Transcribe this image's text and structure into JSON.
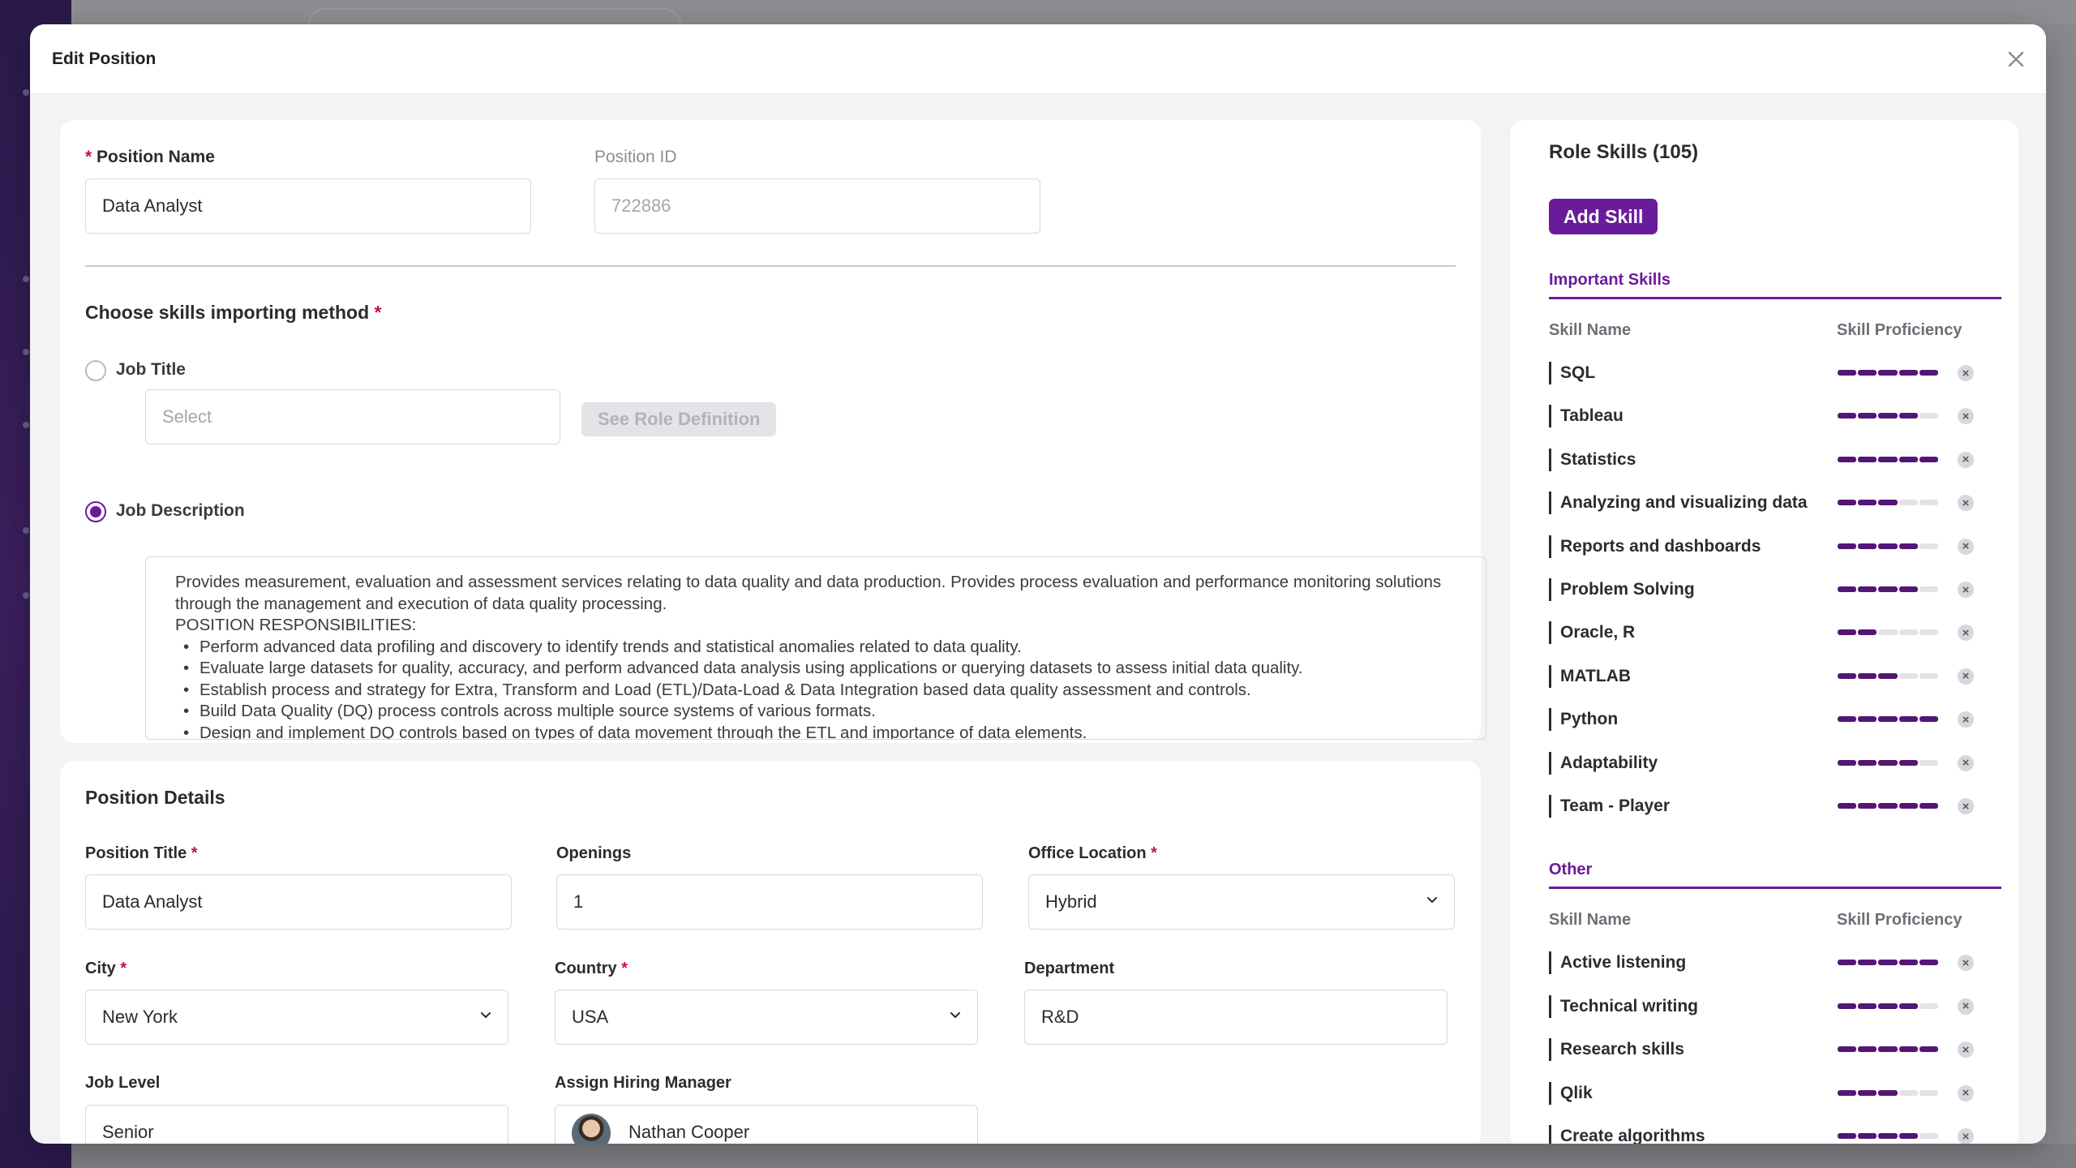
{
  "modal": {
    "title": "Edit Position"
  },
  "position": {
    "name_label": "Position Name",
    "name_value": "Data Analyst",
    "id_label": "Position ID",
    "id_value": "722886"
  },
  "import_method": {
    "title": "Choose skills importing method",
    "job_title_label": "Job Title",
    "job_title_placeholder": "Select",
    "see_role_button": "See Role Definition",
    "job_description_label": "Job Description",
    "description_intro": "Provides measurement, evaluation and assessment services relating to data quality and data production. Provides process evaluation and performance monitoring solutions through the management and execution of data quality processing.",
    "description_heading": "POSITION RESPONSIBILITIES:",
    "responsibilities": [
      "Perform advanced data profiling and discovery to identify trends and statistical anomalies related to data quality.",
      "Evaluate large datasets for quality, accuracy, and perform advanced data analysis using applications or querying datasets to assess initial data quality.",
      "Establish process and strategy for Extra, Transform and Load (ETL)/Data-Load & Data Integration based data quality assessment and controls.",
      "Build Data Quality (DQ) process controls across multiple source systems of various formats.",
      "Design and implement DQ controls based on types of data movement through the ETL and importance of data elements."
    ]
  },
  "details": {
    "title": "Position Details",
    "position_title_label": "Position Title",
    "position_title_value": "Data Analyst",
    "openings_label": "Openings",
    "openings_value": "1",
    "office_location_label": "Office Location",
    "office_location_value": "Hybrid",
    "city_label": "City",
    "city_value": "New York",
    "country_label": "Country",
    "country_value": "USA",
    "department_label": "Department",
    "department_value": "R&D",
    "job_level_label": "Job Level",
    "job_level_value": "Senior",
    "hiring_manager_label": "Assign Hiring Manager",
    "hiring_manager_value": "Nathan Cooper"
  },
  "skills": {
    "title": "Role Skills (105)",
    "add_button": "Add Skill",
    "col_name": "Skill Name",
    "col_proficiency": "Skill Proficiency",
    "groups": [
      {
        "title": "Important Skills",
        "items": [
          {
            "name": "SQL",
            "level": 5
          },
          {
            "name": "Tableau",
            "level": 4
          },
          {
            "name": "Statistics",
            "level": 5
          },
          {
            "name": "Analyzing and visualizing data",
            "level": 3
          },
          {
            "name": "Reports and dashboards",
            "level": 4
          },
          {
            "name": "Problem Solving",
            "level": 4
          },
          {
            "name": "Oracle, R",
            "level": 2
          },
          {
            "name": "MATLAB",
            "level": 3
          },
          {
            "name": "Python",
            "level": 5
          },
          {
            "name": "Adaptability",
            "level": 4
          },
          {
            "name": "Team - Player",
            "level": 5
          }
        ]
      },
      {
        "title": "Other",
        "items": [
          {
            "name": "Active listening",
            "level": 5
          },
          {
            "name": "Technical writing",
            "level": 4
          },
          {
            "name": "Research skills",
            "level": 5
          },
          {
            "name": "Qlik",
            "level": 3
          },
          {
            "name": "Create algorithms",
            "level": 4
          }
        ]
      }
    ],
    "max_level": 5
  }
}
